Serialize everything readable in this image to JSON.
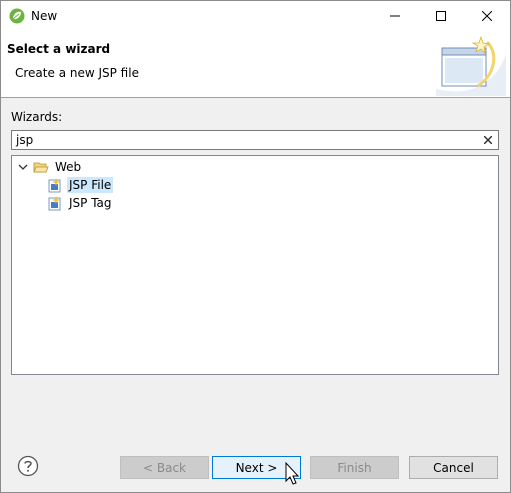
{
  "window": {
    "title": "New"
  },
  "banner": {
    "title": "Select a wizard",
    "description": "Create a new JSP file"
  },
  "wizards": {
    "label": "Wizards:",
    "filter_value": "jsp",
    "tree": [
      {
        "label": "Web",
        "expanded": true,
        "icon": "folder-open-icon"
      },
      {
        "label": "JSP File",
        "selected": true,
        "icon": "jsp-file-icon"
      },
      {
        "label": "JSP Tag",
        "selected": false,
        "icon": "jsp-tag-icon"
      }
    ]
  },
  "buttons": {
    "back": "< Back",
    "next": "Next >",
    "finish": "Finish",
    "cancel": "Cancel"
  },
  "colors": {
    "selection": "#cce8ff",
    "focus_border": "#0078d7",
    "app_icon": "#6db33f"
  }
}
